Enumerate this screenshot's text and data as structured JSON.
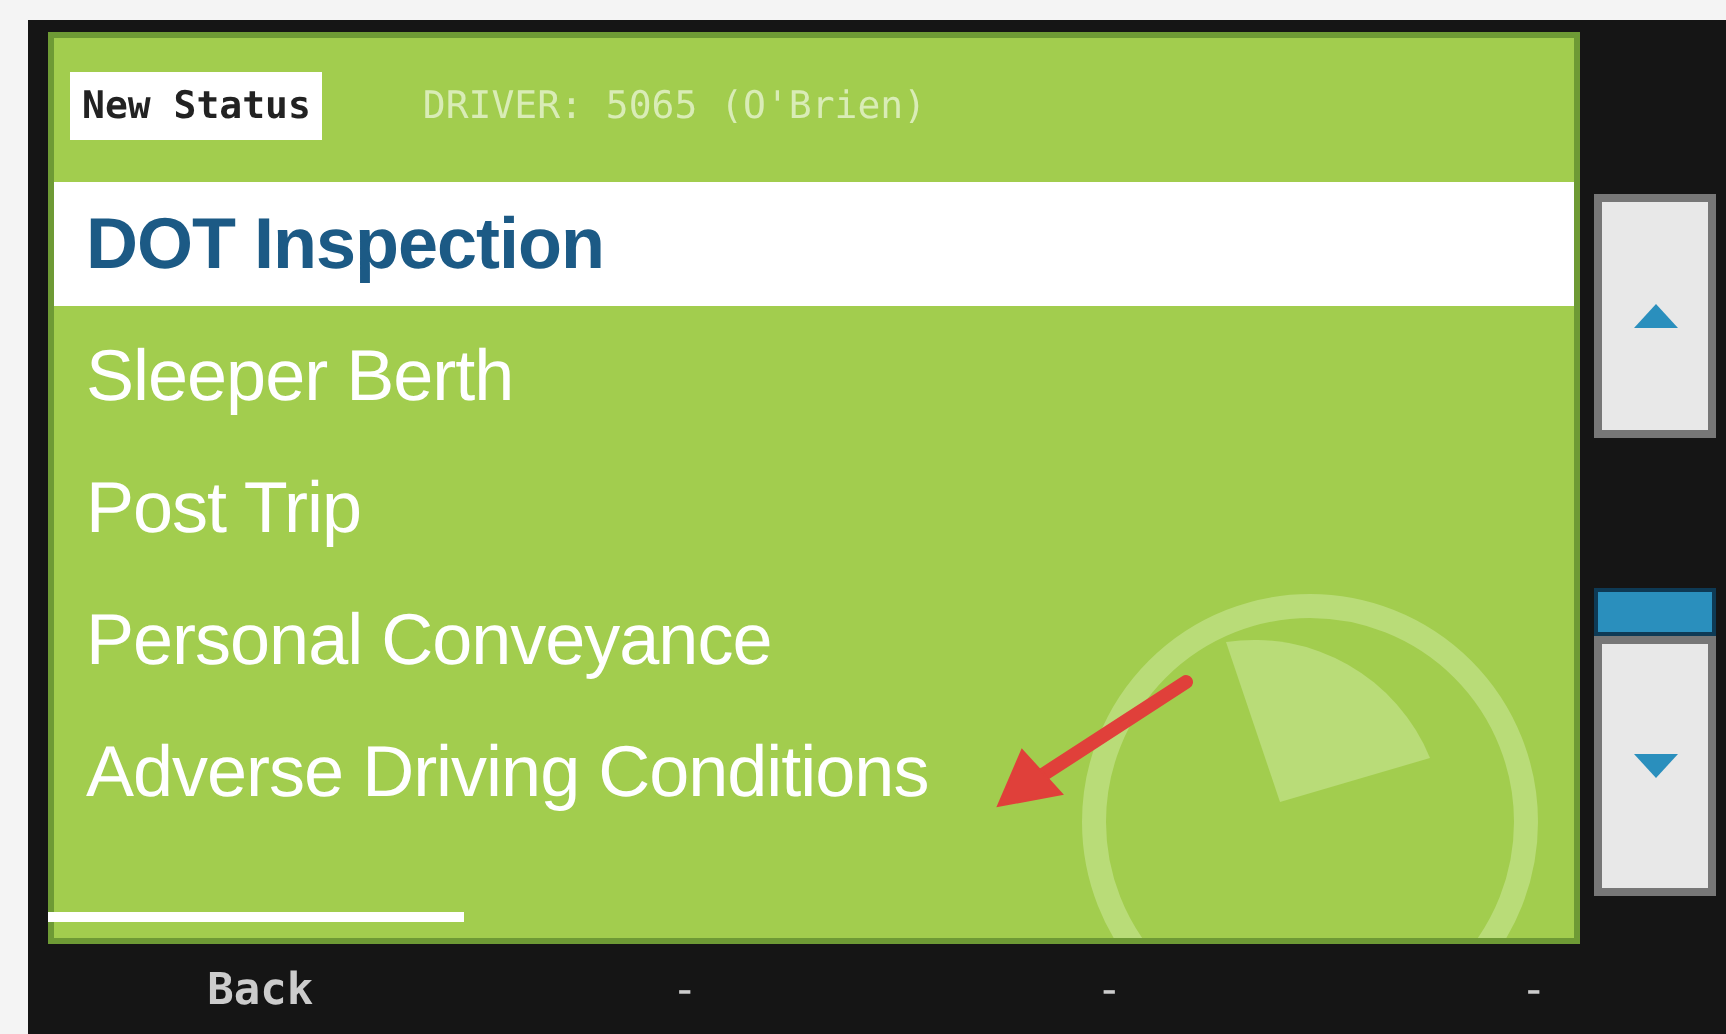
{
  "header": {
    "title": "New Status",
    "driver": "DRIVER:  5065 (O'Brien)"
  },
  "statuses": [
    {
      "label": "DOT Inspection",
      "selected": true
    },
    {
      "label": "Sleeper Berth",
      "selected": false
    },
    {
      "label": "Post Trip",
      "selected": false
    },
    {
      "label": "Personal Conveyance",
      "selected": false
    },
    {
      "label": "Adverse Driving Conditions",
      "selected": false
    }
  ],
  "softkeys": [
    "Back",
    "-",
    "-",
    "-"
  ]
}
